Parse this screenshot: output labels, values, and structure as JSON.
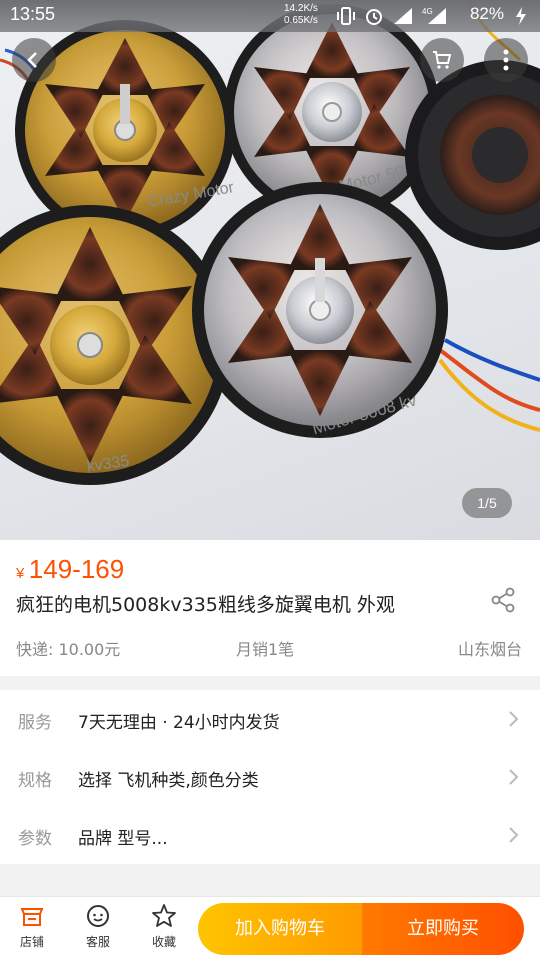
{
  "status_bar": {
    "time": "13:55",
    "net_up": "14.2K/s",
    "net_down": "0.65K/s",
    "battery": "82%"
  },
  "gallery": {
    "pager": "1/5",
    "motor_labels": [
      "Crazy Motor",
      "Crazy Motor 50",
      "kv335",
      "Motor 5008 kv"
    ]
  },
  "product": {
    "currency": "¥",
    "price": "149-169",
    "title": "疯狂的电机5008kv335粗线多旋翼电机  外观",
    "shipping": "快递: 10.00元",
    "monthly_sales": "月销1笔",
    "location": "山东烟台"
  },
  "spec_rows": [
    {
      "key": "服务",
      "value": "7天无理由 · 24小时内发货"
    },
    {
      "key": "规格",
      "value": "选择 飞机种类,颜色分类"
    },
    {
      "key": "参数",
      "value": "品牌 型号..."
    }
  ],
  "bottom_bar": {
    "store": "店铺",
    "service": "客服",
    "favorite": "收藏",
    "add_to_cart": "加入购物车",
    "buy_now": "立即购买"
  },
  "colors": {
    "accent": "#ff5000",
    "cart_gradient": [
      "#ffc400",
      "#ff9a00"
    ],
    "buy_gradient": [
      "#ff7a00",
      "#ff4f00"
    ]
  }
}
